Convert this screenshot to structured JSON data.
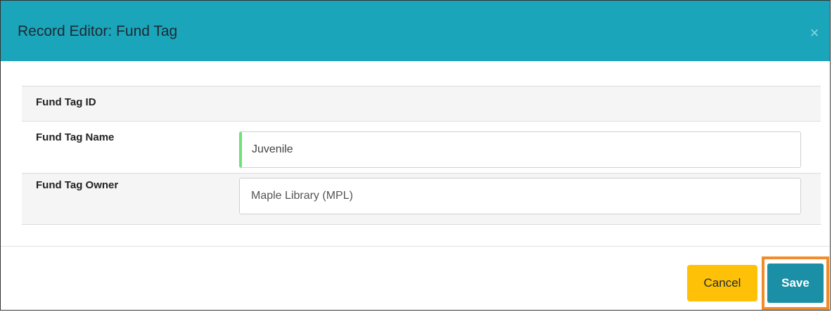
{
  "dialog": {
    "title": "Record Editor: Fund Tag",
    "close_label": "×"
  },
  "form": {
    "fields": [
      {
        "label": "Fund Tag ID",
        "value": ""
      },
      {
        "label": "Fund Tag Name",
        "value": "Juvenile"
      },
      {
        "label": "Fund Tag Owner",
        "value": "Maple Library (MPL)"
      }
    ]
  },
  "footer": {
    "cancel_label": "Cancel",
    "save_label": "Save"
  },
  "colors": {
    "header_bg": "#1ba5ba",
    "cancel_bg": "#ffc107",
    "save_bg": "#1b8fa6",
    "highlight": "#f28c28",
    "active_field_indicator": "#6fe07a"
  }
}
